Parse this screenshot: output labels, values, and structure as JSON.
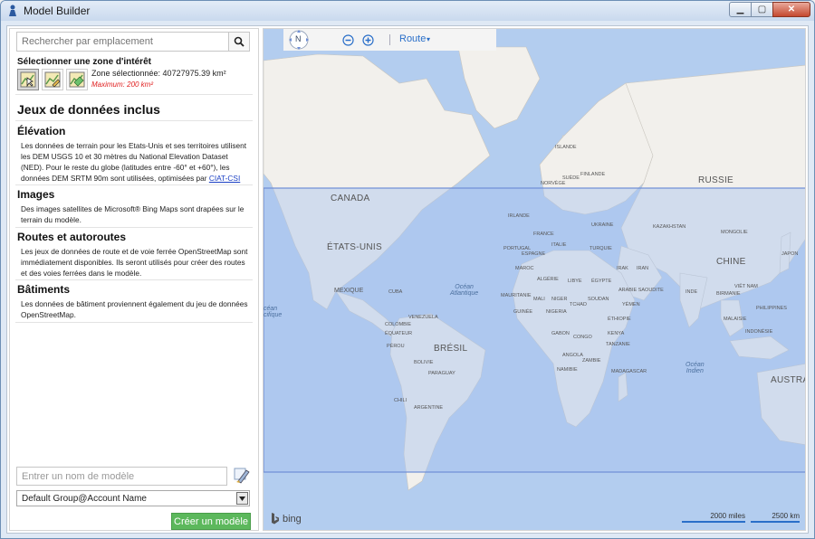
{
  "window": {
    "title": "Model Builder",
    "min_glyph": "▁",
    "max_glyph": "▢",
    "close_glyph": "✕"
  },
  "search": {
    "placeholder": "Rechercher par emplacement",
    "icon": "search-icon"
  },
  "aoi": {
    "title": "Sélectionner une zone d'intérêt",
    "zone_selected": "Zone sélectionnée: 40727975.39 km²",
    "maximum": "Maximum: 200 km²"
  },
  "datasets": {
    "title": "Jeux de données inclus",
    "elevation": {
      "title": "Élévation",
      "body": "Les données de terrain pour les Etats-Unis et ses territoires utilisent les DEM USGS 10 et 30 mètres du National Elevation Dataset (NED). Pour le reste du globe (latitudes entre -60° et +60°), les données DEM SRTM 90m sont utilisées, optimisées par ",
      "link": "CIAT-CSI"
    },
    "images": {
      "title": "Images",
      "body": "Des images satellites de Microsoft® Bing Maps sont drapées sur le terrain du modèle."
    },
    "roads": {
      "title": "Routes et autoroutes",
      "body": "Les jeux de données de route et de voie ferrée OpenStreetMap sont immédiatement disponibles. Ils seront utilisés pour créer des routes et des voies ferrées dans le modèle."
    },
    "buildings": {
      "title": "Bâtiments",
      "body": "Les données de bâtiment proviennent également du jeu de données OpenStreetMap."
    }
  },
  "model": {
    "name_placeholder": "Entrer un nom de modèle",
    "group_selected": "Default Group@Account Name",
    "create_label": "Créer un modèle"
  },
  "map": {
    "nav_label": "N",
    "style_label": "Route",
    "caret": "▾",
    "brand": "bing",
    "scale_miles": "2000 miles",
    "scale_km": "2500 km",
    "labels": {
      "russia": "RUSSIE",
      "canada": "CANADA",
      "usa": "ÉTATS-UNIS",
      "mexico": "MEXIQUE",
      "brazil": "BRÉSIL",
      "china": "CHINE",
      "australia": "AUSTRAL",
      "atlantic_1": "Océan",
      "atlantic_2": "Atlantique",
      "indian_1": "Océan",
      "indian_2": "Indien",
      "pacific_1": "céan",
      "pacific_2": "cifique",
      "irlande": "IRLANDE",
      "france": "FRANCE",
      "ukraine": "UKRAINE",
      "portugal": "PORTUGAL",
      "espagne": "ESPAGNE",
      "italie": "ITALIE",
      "turquie": "TURQUIE",
      "kazakhstan": "KAZAKHSTAN",
      "mongolie": "MONGOLIE",
      "japon": "JAPON",
      "maroc": "MAROC",
      "algerie": "ALGÉRIE",
      "libye": "LIBYE",
      "egypte": "ÉGYPTE",
      "irak": "IRAK",
      "iran": "IRAN",
      "arabie": "ARABIE SAOUDITE",
      "inde": "INDE",
      "mali": "MALI",
      "niger": "NIGER",
      "tchad": "TCHAD",
      "soudan": "SOUDAN",
      "mauritanie": "MAURITANIE",
      "nigeria": "NIGERIA",
      "ethiopie": "ÉTHIOPIE",
      "congo": "CONGO",
      "angola": "ANGOLA",
      "zambie": "ZAMBIE",
      "namibie": "NAMIBIE",
      "tanzanie": "TANZANIE",
      "kenya": "KENYA",
      "madagascar": "MADAGASCAR",
      "yemen": "YÉMEN",
      "vietnam": "VIÊT NAM",
      "philippines": "PHILIPPINES",
      "indonesie": "INDONÉSIE",
      "malaisie": "MALAISIE",
      "birmanie": "BIRMANIE",
      "cuba": "CUBA",
      "venezuela": "VENEZUELA",
      "colombie": "COLOMBIE",
      "equateur": "ÉQUATEUR",
      "perou": "PÉROU",
      "bolivie": "BOLIVIE",
      "paraguay": "PARAGUAY",
      "chili": "CHILI",
      "argentine": "ARGENTINE",
      "gabon": "GABON",
      "guinee": "GUINÉE",
      "norvege": "NORVÈGE",
      "suede": "SUÈDE",
      "finlande": "FINLANDE",
      "islande": "ISLANDE"
    }
  },
  "colors": {
    "accent": "#2a6fc9",
    "create_button": "#5cb85c",
    "maximum_text": "#e02020",
    "selection": "#a8c4f0"
  }
}
